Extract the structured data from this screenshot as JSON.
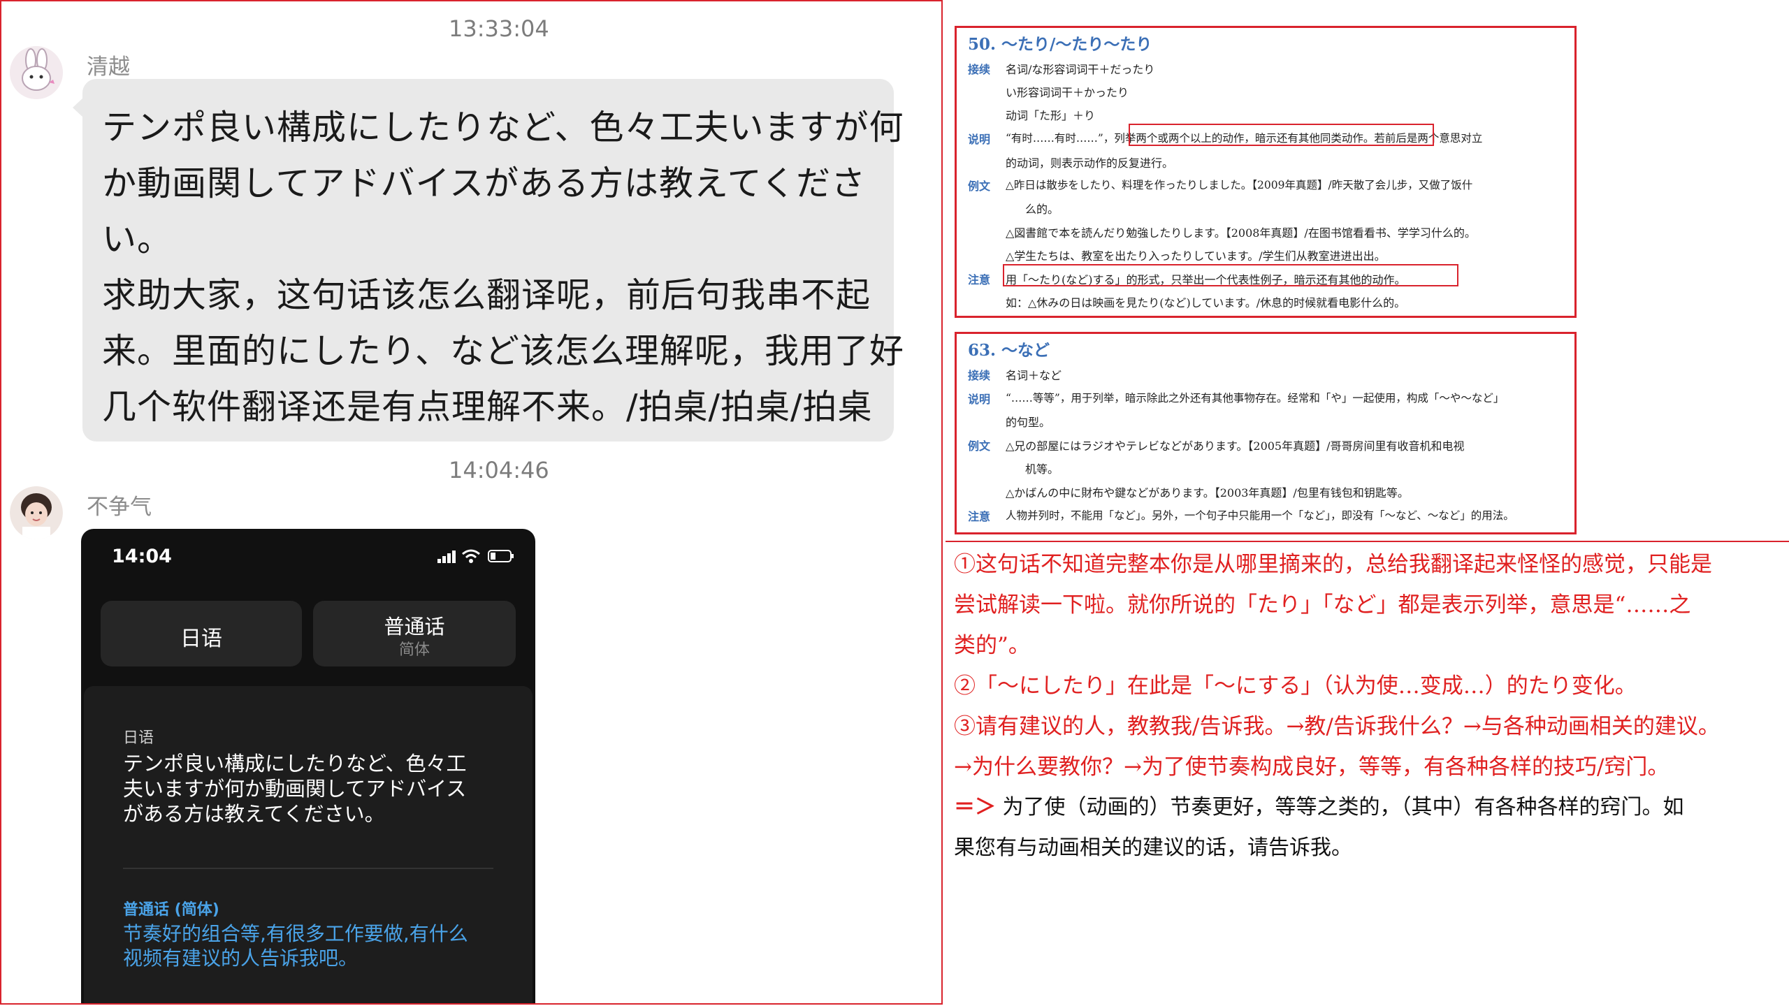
{
  "chat": {
    "messages": [
      {
        "timestamp": "13:33:04",
        "sender": "清越",
        "avatar": "rabbit-avatar-icon",
        "lines": [
          "テンポ良い構成にしたりなど、色々工夫いますが何",
          "か動画関してアドバイスがある方は教えてくださ",
          "い。",
          "求助大家，这句话该怎么翻译呢，前后句我串不起",
          "来。里面的にしたり、など该怎么理解呢，我用了好",
          "几个软件翻译还是有点理解不来。/拍桌/拍桌/拍桌"
        ]
      },
      {
        "timestamp": "14:04:46",
        "sender": "不争气",
        "avatar": "girl-avatar-icon"
      }
    ],
    "phone": {
      "time": "14:04",
      "source_lang_button": "日语",
      "target_lang_button": "普通话",
      "target_lang_sub": "简体",
      "source_label": "日语",
      "source_text": [
        "テンポ良い構成にしたりなど、色々工",
        "夫いますが何か動画関してアドバイス",
        "がある方は教えてください。"
      ],
      "target_label": "普通话 (简体)",
      "target_text": [
        "节奏好的组合等,有很多工作要做,有什么",
        "视频有建议的人告诉我吧。"
      ]
    }
  },
  "reference": {
    "box1": {
      "heading": "50. 〜たり/〜たり〜たり",
      "rows": [
        {
          "label": "接续",
          "text": "名词/な形容词词干＋だったり"
        },
        {
          "label": "",
          "text": "い形容词词干＋かったり"
        },
        {
          "label": "",
          "text": "动词「た形」＋り"
        },
        {
          "label": "说明",
          "text": "“有时……有时……”，列举两个或两个以上的动作，暗示还有其他同类动作。若前后是两个意思对立"
        },
        {
          "label": "",
          "text": "的动词，则表示动作的反复进行。"
        },
        {
          "label": "例文",
          "text": "△昨日は散歩をしたり、料理を作ったりしました。【2009年真题】/昨天散了会儿步，又做了饭什"
        },
        {
          "label": "",
          "text": "么的。"
        },
        {
          "label": "",
          "text": "△図書館で本を読んだり勉強したりします。【2008年真题】/在图书馆看看书、学学习什么的。"
        },
        {
          "label": "",
          "text": "△学生たちは、教室を出たり入ったりしています。/学生们从教室进进出出。"
        },
        {
          "label": "注意",
          "text": "用「〜たり(など)する」的形式，只举出一个代表性例子，暗示还有其他的动作。"
        },
        {
          "label": "",
          "text": "如：△休みの日は映画を見たり(など)しています。/休息的时候就看电影什么的。"
        }
      ]
    },
    "box2": {
      "heading": "63. 〜など",
      "rows": [
        {
          "label": "接续",
          "text": "名词＋など"
        },
        {
          "label": "说明",
          "text": "“……等等”，用于列举，暗示除此之外还有其他事物存在。经常和「や」一起使用，构成「〜や〜など」"
        },
        {
          "label": "",
          "text": "的句型。"
        },
        {
          "label": "例文",
          "text": "△兄の部屋にはラジオやテレビなどがあります。【2005年真题】/哥哥房间里有收音机和电视"
        },
        {
          "label": "",
          "text": "机等。"
        },
        {
          "label": "",
          "text": "△かばんの中に財布や鍵などがあります。【2003年真题】/包里有钱包和钥匙等。"
        },
        {
          "label": "注意",
          "text": "人物并列时，不能用「など」。另外，一个句子中只能用一个「など」，即没有「〜など、〜など」的用法。"
        }
      ]
    }
  },
  "notes": {
    "red_lines": [
      "①这句话不知道完整本你是从哪里摘来的，总给我翻译起来怪怪的感觉，只能是",
      "尝试解读一下啦。就你所说的「たり」「など」都是表示列举，意思是“……之",
      "类的”。",
      "②「〜にしたり」在此是「〜にする」（认为使…变成…）的たり变化。",
      "③请有建议的人，教教我/告诉我。→教/告诉我什么？→与各种动画相关的建议。",
      "→为什么要教你？→为了使节奏构成良好，等等，有各种各样的技巧/窍门。"
    ],
    "arrow": "＝＞",
    "conclusion": [
      "为了使（动画的）节奏更好，等等之类的，（其中）有各种各样的窍门。如",
      "果您有与动画相关的建议的话，请告诉我。"
    ]
  },
  "colors": {
    "accent_red": "#d9232d",
    "note_red": "#e02020",
    "heading_blue": "#3b6fb6",
    "bubble_gray": "#e9e9e9",
    "phone_bg": "#111111"
  }
}
